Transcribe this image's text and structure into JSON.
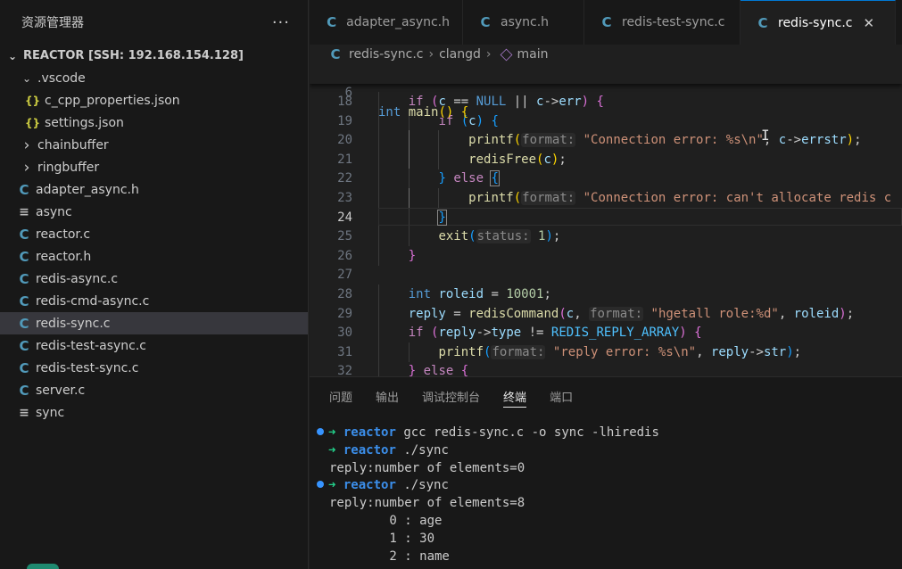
{
  "sidebar": {
    "title": "资源管理器",
    "more_label": "···",
    "root_label": "REACTOR [SSH: 192.168.154.128]",
    "items": [
      {
        "label": ".vscode",
        "kind": "folder-open",
        "depth": 1
      },
      {
        "label": "c_cpp_properties.json",
        "kind": "json",
        "depth": 2
      },
      {
        "label": "settings.json",
        "kind": "json",
        "depth": 2
      },
      {
        "label": "chainbuffer",
        "kind": "folder",
        "depth": 1
      },
      {
        "label": "ringbuffer",
        "kind": "folder",
        "depth": 1
      },
      {
        "label": "adapter_async.h",
        "kind": "c",
        "depth": 1
      },
      {
        "label": "async",
        "kind": "binary",
        "depth": 1
      },
      {
        "label": "reactor.c",
        "kind": "c",
        "depth": 1
      },
      {
        "label": "reactor.h",
        "kind": "c",
        "depth": 1
      },
      {
        "label": "redis-async.c",
        "kind": "c",
        "depth": 1
      },
      {
        "label": "redis-cmd-async.c",
        "kind": "c",
        "depth": 1
      },
      {
        "label": "redis-sync.c",
        "kind": "c",
        "depth": 1,
        "selected": true
      },
      {
        "label": "redis-test-async.c",
        "kind": "c",
        "depth": 1
      },
      {
        "label": "redis-test-sync.c",
        "kind": "c",
        "depth": 1
      },
      {
        "label": "server.c",
        "kind": "c",
        "depth": 1
      },
      {
        "label": "sync",
        "kind": "binary",
        "depth": 1
      }
    ]
  },
  "icons": {
    "c_file": "C",
    "json_file": "{}",
    "binary_file": "≡",
    "close": "✕",
    "chevron_right": "›",
    "chevron_down": "⌄"
  },
  "tabs": [
    {
      "label": "adapter_async.h",
      "active": false
    },
    {
      "label": "async.h",
      "active": false
    },
    {
      "label": "redis-test-sync.c",
      "active": false
    },
    {
      "label": "redis-sync.c",
      "active": true
    }
  ],
  "breadcrumb": {
    "file": "redis-sync.c",
    "ext": "clangd",
    "symbol": "main"
  },
  "editor": {
    "sticky": {
      "line_number": "6",
      "text": "int main() {"
    },
    "current_line": "24",
    "lines": [
      {
        "n": "18",
        "text": "if (c == NULL || c->err) {"
      },
      {
        "n": "19",
        "text": "if (c) {"
      },
      {
        "n": "20",
        "text": "printf(format: \"Connection error: %s\\n\", c->errstr);"
      },
      {
        "n": "21",
        "text": "redisFree(c);"
      },
      {
        "n": "22",
        "text": "} else {"
      },
      {
        "n": "23",
        "text": "printf(format: \"Connection error: can't allocate redis c"
      },
      {
        "n": "24",
        "text": "}"
      },
      {
        "n": "25",
        "text": "exit(status: 1);"
      },
      {
        "n": "26",
        "text": "}"
      },
      {
        "n": "27",
        "text": ""
      },
      {
        "n": "28",
        "text": "int roleid = 10001;"
      },
      {
        "n": "29",
        "text": "reply = redisCommand(c, format: \"hgetall role:%d\", roleid);"
      },
      {
        "n": "30",
        "text": "if (reply->type != REDIS_REPLY_ARRAY) {"
      },
      {
        "n": "31",
        "text": "printf(format: \"reply error: %s\\n\", reply->str);"
      },
      {
        "n": "32",
        "text": "} else {"
      }
    ]
  },
  "panel": {
    "tabs": [
      {
        "label": "问题",
        "active": false
      },
      {
        "label": "输出",
        "active": false
      },
      {
        "label": "调试控制台",
        "active": false
      },
      {
        "label": "终端",
        "active": true
      },
      {
        "label": "端口",
        "active": false
      }
    ],
    "terminal": [
      {
        "prompt": true,
        "arrow": "➜",
        "dir": "reactor",
        "cmd": "gcc redis-sync.c -o sync -lhiredis"
      },
      {
        "prompt": true,
        "arrow": "➜",
        "dir": "reactor",
        "cmd": "./sync",
        "no_dot": true
      },
      {
        "prompt": false,
        "text": "reply:number of elements=0"
      },
      {
        "prompt": true,
        "arrow": "➜",
        "dir": "reactor",
        "cmd": "./sync"
      },
      {
        "prompt": false,
        "text": "reply:number of elements=8"
      },
      {
        "prompt": false,
        "text": "        0 : age"
      },
      {
        "prompt": false,
        "text": "        1 : 30"
      },
      {
        "prompt": false,
        "text": "        2 : name"
      }
    ]
  }
}
